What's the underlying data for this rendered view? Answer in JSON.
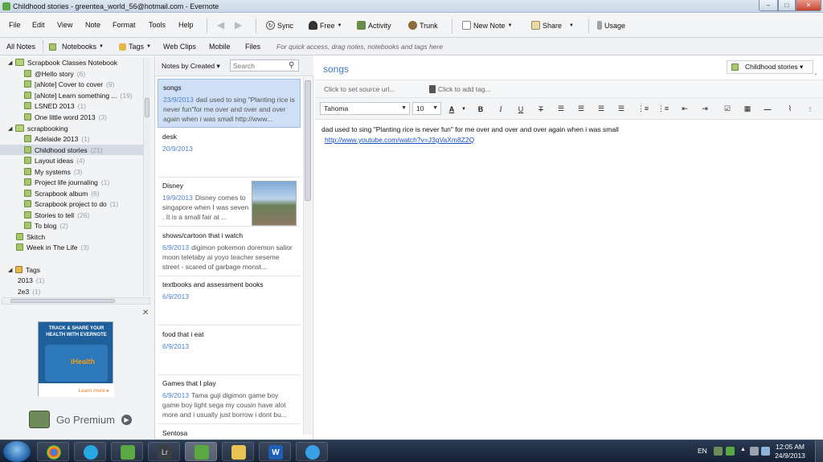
{
  "window": {
    "title": "Childhood stories - greentea_world_56@hotmail.com - Evernote",
    "min": "–",
    "max": "□",
    "close": "✕"
  },
  "menu": {
    "items": [
      "File",
      "Edit",
      "View",
      "Note",
      "Format",
      "Tools",
      "Help"
    ]
  },
  "toolbar": {
    "sync": "Sync",
    "account": "Free",
    "activity": "Activity",
    "trunk": "Trunk",
    "new_note": "New Note",
    "share": "Share",
    "usage": "Usage"
  },
  "toolbar2": {
    "all_notes": "All Notes",
    "notebooks": "Notebooks",
    "tags": "Tags",
    "web_clips": "Web Clips",
    "mobile": "Mobile",
    "files": "Files",
    "hint": "For quick access, drag notes, notebooks and tags here"
  },
  "sidebar": {
    "items": [
      {
        "label": "Scrapbook Classes Notebook",
        "count": "",
        "kind": "stack"
      },
      {
        "label": "@Hello story",
        "count": "(6)",
        "kind": "notebook"
      },
      {
        "label": "[aNote] Cover to cover",
        "count": "(9)",
        "kind": "notebook"
      },
      {
        "label": "[aNote] Learn something ...",
        "count": "(19)",
        "kind": "notebook"
      },
      {
        "label": "LSNED 2013",
        "count": "(1)",
        "kind": "notebook"
      },
      {
        "label": "One little word 2013",
        "count": "(3)",
        "kind": "notebook"
      },
      {
        "label": "scrapbooking",
        "count": "",
        "kind": "stack"
      },
      {
        "label": "Adelaide 2013",
        "count": "(1)",
        "kind": "notebook"
      },
      {
        "label": "Childhood stories",
        "count": "(21)",
        "kind": "notebook"
      },
      {
        "label": "Layout ideas",
        "count": "(4)",
        "kind": "notebook"
      },
      {
        "label": "My systems",
        "count": "(3)",
        "kind": "notebook"
      },
      {
        "label": "Project life journaling",
        "count": "(1)",
        "kind": "notebook"
      },
      {
        "label": "Scrapbook album",
        "count": "(6)",
        "kind": "notebook"
      },
      {
        "label": "Scrapbook project to do",
        "count": "(1)",
        "kind": "notebook"
      },
      {
        "label": "Stories to tell",
        "count": "(26)",
        "kind": "notebook"
      },
      {
        "label": "To blog",
        "count": "(2)",
        "kind": "notebook"
      },
      {
        "label": "Skitch",
        "count": "",
        "kind": "notebook"
      },
      {
        "label": "Week in The Life",
        "count": "(3)",
        "kind": "notebook"
      },
      {
        "label": "Tags",
        "count": "",
        "kind": "tags"
      },
      {
        "label": "2013",
        "count": "(1)",
        "kind": "tag"
      },
      {
        "label": "2e3",
        "count": "(1)",
        "kind": "tag"
      }
    ],
    "ad": {
      "text": "TRACK & SHARE YOUR HEALTH WITH EVERNOTE",
      "brand": "iHealth",
      "more": "Learn more ▸"
    },
    "go_premium": "Go Premium"
  },
  "notelist": {
    "sort_label": "Notes by Created ▾",
    "search_placeholder": "Search",
    "notes": [
      {
        "title": "songs",
        "date": "23/9/2013",
        "snippet": "dad used to sing \"Planting rice is never fun\"for me over and over and over again when i was small http://www..."
      },
      {
        "title": "desk",
        "date": "20/9/2013",
        "snippet": ""
      },
      {
        "title": "Disney",
        "date": "19/9/2013",
        "snippet": "Disney comes to singapore when I was seven . It is a small fair at ..."
      },
      {
        "title": "shows/cartoon that i watch",
        "date": "6/9/2013",
        "snippet": "digimon pokemon doremon salior moon teletaby ai yoyo teacher seseme street - scared of garbage monst..."
      },
      {
        "title": "textbooks and assessment books",
        "date": "6/9/2013",
        "snippet": ""
      },
      {
        "title": "food that i eat",
        "date": "6/9/2013",
        "snippet": ""
      },
      {
        "title": "Games that I play",
        "date": "6/9/2013",
        "snippet": "Tama guji digimon game boy game boy light sega my cousin have alot more and i usually just borrow i dont bu..."
      },
      {
        "title": "Sentosa",
        "date": "",
        "snippet": ""
      }
    ]
  },
  "editor": {
    "title": "songs",
    "notebook": "Childhood stories ▾",
    "source_url_placeholder": "Click to set source url...",
    "tag_placeholder": "Click to add tag...",
    "font": "Tahoma",
    "size": "10",
    "body_text": "dad used to sing \"Planting rice is never fun\" for me over and over and over again when i was small",
    "body_link": "http://www.youtube.com/watch?v=J3gVaXm8Z2Q"
  },
  "taskbar": {
    "lang": "EN",
    "time": "12:05 AM",
    "date": "24/9/2013"
  },
  "colors": {
    "accent": "#3b7bbf",
    "selected_note": "#cfe0f6",
    "taskbar": "#142035",
    "link": "#1a4fc4"
  }
}
